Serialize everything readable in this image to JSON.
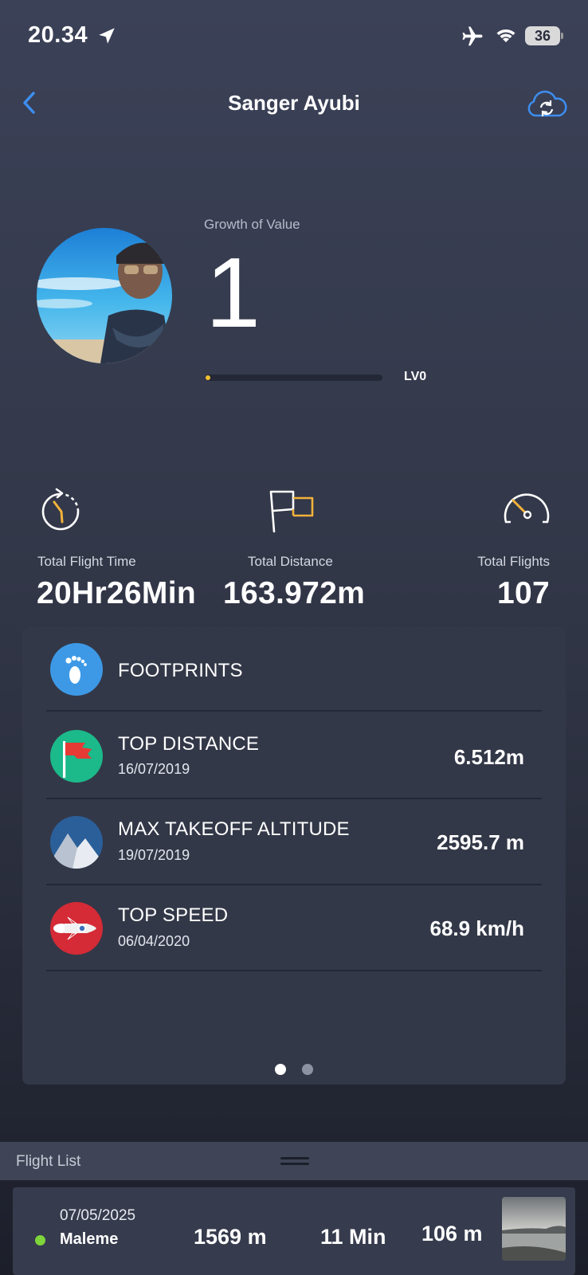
{
  "status_bar": {
    "time": "20.34",
    "battery": "36",
    "icons": [
      "location-arrow-icon",
      "airplane-icon",
      "wifi-icon",
      "battery-icon"
    ]
  },
  "header": {
    "title": "Sanger Ayubi",
    "back_icon": "chevron-left-icon",
    "sync_icon": "cloud-sync-icon"
  },
  "profile": {
    "growth_label": "Growth of Value",
    "growth_value": "1",
    "level_label": "LV0",
    "level_progress": 0.01,
    "colors": {
      "level_dot": "#f2c230",
      "level_track": "#242836"
    }
  },
  "stats": [
    {
      "label": "Total Flight Time",
      "value": "20Hr26Min",
      "icon": "stopwatch-icon"
    },
    {
      "label": "Total Distance",
      "value": "163.972m",
      "icon": "flag-icon"
    },
    {
      "label": "Total Flights",
      "value": "107",
      "icon": "speedometer-icon"
    }
  ],
  "footprints": {
    "title": "FOOTPRINTS",
    "icon": "footprint-icon",
    "rows": [
      {
        "title": "TOP DISTANCE",
        "date": "16/07/2019",
        "value": "6.512m",
        "icon": "red-flag-icon"
      },
      {
        "title": "MAX TAKEOFF ALTITUDE",
        "date": "19/07/2019",
        "value": "2595.7 m",
        "icon": "mountain-icon"
      },
      {
        "title": "TOP SPEED",
        "date": "06/04/2020",
        "value": "68.9 km/h",
        "icon": "rocket-icon"
      }
    ],
    "pagination": {
      "pages": 2,
      "active": 1
    }
  },
  "flight_list": {
    "label": "Flight List",
    "items": [
      {
        "date": "07/05/2025",
        "place": "Maleme",
        "distance": "1569 m",
        "duration": "11 Min",
        "altitude": "106 m",
        "status_color": "#7ed43a"
      }
    ]
  }
}
